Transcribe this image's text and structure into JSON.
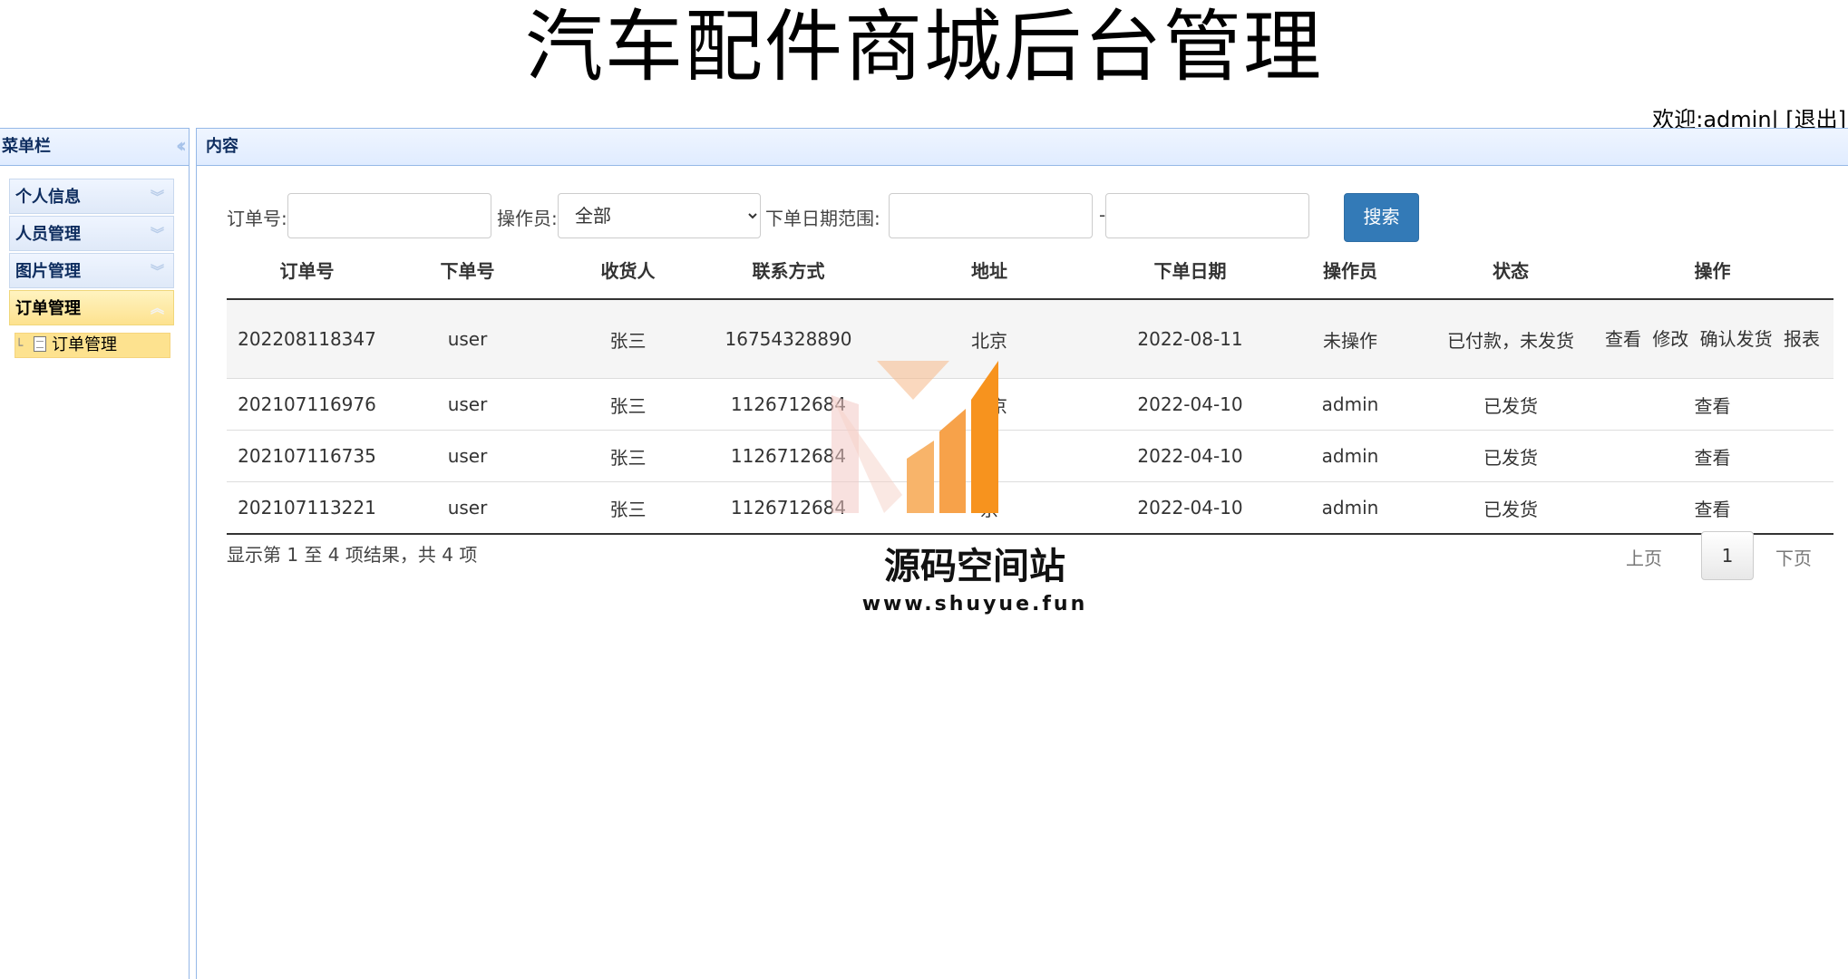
{
  "header": {
    "title": "汽车配件商城后台管理",
    "welcome": "欢迎:admin|",
    "logout": "[退出]"
  },
  "west": {
    "title": "菜单栏",
    "collapse_icon": "double-chevron-left-icon",
    "menu": [
      {
        "label": "个人信息",
        "active": false
      },
      {
        "label": "人员管理",
        "active": false
      },
      {
        "label": "图片管理",
        "active": false
      },
      {
        "label": "订单管理",
        "active": true
      }
    ],
    "tree_item": "订单管理"
  },
  "center": {
    "title": "内容"
  },
  "search": {
    "order_no_label": "订单号:",
    "order_no_value": "",
    "operator_label": "操作员:",
    "operator_selected": "全部",
    "date_range_label": "下单日期范围:",
    "date_from": "",
    "date_sep": "-",
    "date_to": "",
    "button": "搜索"
  },
  "table": {
    "headers": [
      "订单号",
      "下单号",
      "收货人",
      "联系方式",
      "地址",
      "下单日期",
      "操作员",
      "状态",
      "操作"
    ],
    "rows": [
      {
        "order_no": "202208118347",
        "user": "user",
        "receiver": "张三",
        "phone": "16754328890",
        "address": "北京",
        "date": "2022-08-11",
        "operator": "未操作",
        "status": "已付款，未发货",
        "actions": [
          "查看",
          "修改",
          "确认发货",
          "报表"
        ]
      },
      {
        "order_no": "202107116976",
        "user": "user",
        "receiver": "张三",
        "phone": "1126712684",
        "address": "北京",
        "date": "2022-04-10",
        "operator": "admin",
        "status": "已发货",
        "actions": [
          "查看"
        ]
      },
      {
        "order_no": "202107116735",
        "user": "user",
        "receiver": "张三",
        "phone": "1126712684",
        "address": "京",
        "date": "2022-04-10",
        "operator": "admin",
        "status": "已发货",
        "actions": [
          "查看"
        ]
      },
      {
        "order_no": "202107113221",
        "user": "user",
        "receiver": "张三",
        "phone": "1126712684",
        "address": "京",
        "date": "2022-04-10",
        "operator": "admin",
        "status": "已发货",
        "actions": [
          "查看"
        ]
      }
    ]
  },
  "summary": "显示第 1 至 4 项结果，共 4 项",
  "pager": {
    "prev": "上页",
    "current": "1",
    "next": "下页"
  },
  "watermark": {
    "name": "源码空间站",
    "url": "www.shuyue.fun"
  },
  "colors": {
    "accent": "#337ab7",
    "panel_border": "#95b8e7",
    "active_menu": "#fde28f",
    "watermark_orange": "#f7931e"
  }
}
